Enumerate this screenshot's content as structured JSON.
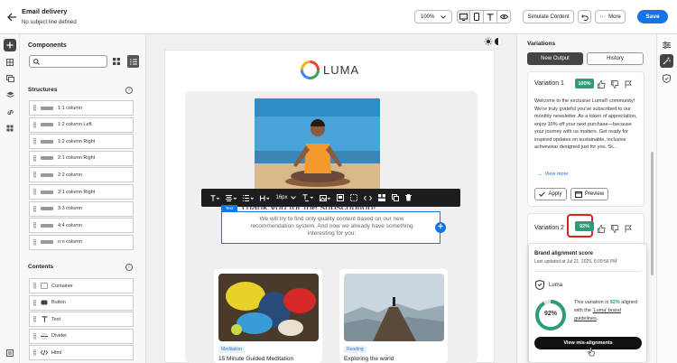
{
  "header": {
    "title": "Email delivery",
    "subject": "No subject line defined",
    "zoom": "100%",
    "simulate_label": "Simulate Content",
    "more_label": "More",
    "save_label": "Save"
  },
  "components": {
    "title": "Components",
    "search_placeholder": "",
    "structures_label": "Structures",
    "structures": [
      "1:1 column",
      "1:2 column Left",
      "1:2 column Right",
      "2:1 column Right",
      "2:2 column",
      "3:1 column Right",
      "3:3 column",
      "4:4 column",
      "n:n column"
    ],
    "contents_label": "Contents",
    "contents": [
      "Container",
      "Button",
      "Text",
      "Divider",
      "Html"
    ]
  },
  "canvas": {
    "logo_text": "LUMA",
    "toolbar_font_size": "16px",
    "headline": "Thank you for the subscription!",
    "selected_tag": "Text",
    "body_text": "We will try to find only quality content based on our new recommendation system. And now we already have something interesting for you:",
    "card1": {
      "tag": "Meditation",
      "title": "15 Minute Guided Meditation"
    },
    "card2": {
      "tag": "Reading",
      "title": "Exploring the world"
    }
  },
  "variations": {
    "title": "Variations",
    "tab_new": "New Output",
    "tab_history": "History",
    "v1": {
      "name": "Variation 1",
      "score": "100%",
      "text": "Welcome to the exclusive Luma® community! We're truly grateful you've subscribed to our monthly newsletter. As a token of appreciation, enjoy 10% off your next purchase—because your journey with us matters. Get ready for inspired updates on sustainable, inclusive activewear designed just for you. St...",
      "view_more": "View more",
      "apply": "Apply",
      "preview": "Preview"
    },
    "v2": {
      "name": "Variation 2",
      "score": "92%"
    }
  },
  "popover": {
    "title": "Brand alignment score",
    "updated": "Last updated at Jul 21, 2025, 6:09:56 PM",
    "brand": "Luma",
    "ring_value": "92%",
    "ring_fraction": 0.92,
    "text_prefix": "This variation is ",
    "text_pct": "92%",
    "text_mid": " aligned with the ",
    "text_link": "'Luma' brand guidelines",
    "text_suffix": ".",
    "button": "View mis-alignments"
  },
  "colors": {
    "accent": "#1473e6",
    "score": "#2d9d78",
    "highlight": "#e02020",
    "ring_track": "#e0e0e0"
  }
}
